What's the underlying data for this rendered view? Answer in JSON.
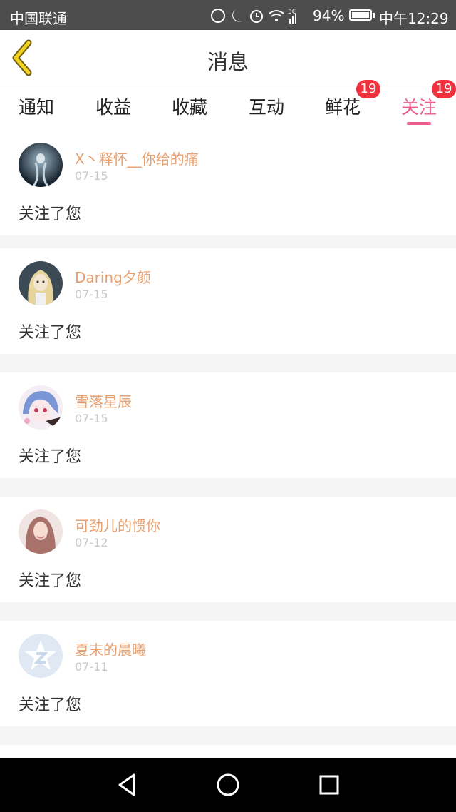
{
  "status_bar": {
    "carrier": "中国联通",
    "network": "3G",
    "battery": "94%",
    "time": "中午12:29"
  },
  "header": {
    "title": "消息"
  },
  "tabs": [
    {
      "label": "通知"
    },
    {
      "label": "收益"
    },
    {
      "label": "收藏"
    },
    {
      "label": "互动"
    },
    {
      "label": "鲜花",
      "badge": "19"
    },
    {
      "label": "关注",
      "badge": "19",
      "active": true
    }
  ],
  "accent_color": "#ef5d8c",
  "messages": [
    {
      "username": "X丶释怀__你给的痛",
      "date": "07-15",
      "text": "关注了您",
      "avatar": "avatar-dark-figure"
    },
    {
      "username": "Daring夕颜",
      "date": "07-15",
      "text": "关注了您",
      "avatar": "avatar-blonde-girl"
    },
    {
      "username": "雪落星辰",
      "date": "07-15",
      "text": "关注了您",
      "avatar": "avatar-anime-girl"
    },
    {
      "username": "可劲儿的惯你",
      "date": "07-12",
      "text": "关注了您",
      "avatar": "avatar-girl-photo"
    },
    {
      "username": "夏末的晨曦",
      "date": "07-11",
      "text": "关注了您",
      "avatar": "avatar-default-qzone"
    }
  ]
}
